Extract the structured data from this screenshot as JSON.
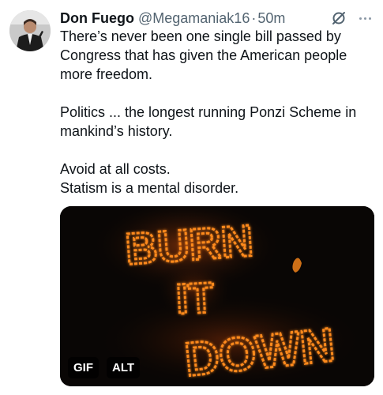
{
  "tweet": {
    "author": {
      "display_name": "Don Fuego",
      "handle": "@Megamaniak16",
      "separator": "·",
      "time": "50m"
    },
    "lines": [
      "There’s never been one single bill passed by",
      "Congress that has given the American people",
      "more freedom.",
      "Politics ... the longest running Ponzi Scheme in",
      "mankind’s history.",
      "Avoid at all costs.",
      "Statism is a mental disorder."
    ],
    "media": {
      "fire_text": [
        "BURN",
        "IT",
        "DOWN"
      ],
      "gif_badge": "GIF",
      "alt_badge": "ALT"
    },
    "icons": [
      "grok-icon",
      "more-options-icon"
    ]
  },
  "colors": {
    "text": "#0f1419",
    "secondary_text": "#536471",
    "fire": "#ff8a1c",
    "media_background": "#090605"
  }
}
